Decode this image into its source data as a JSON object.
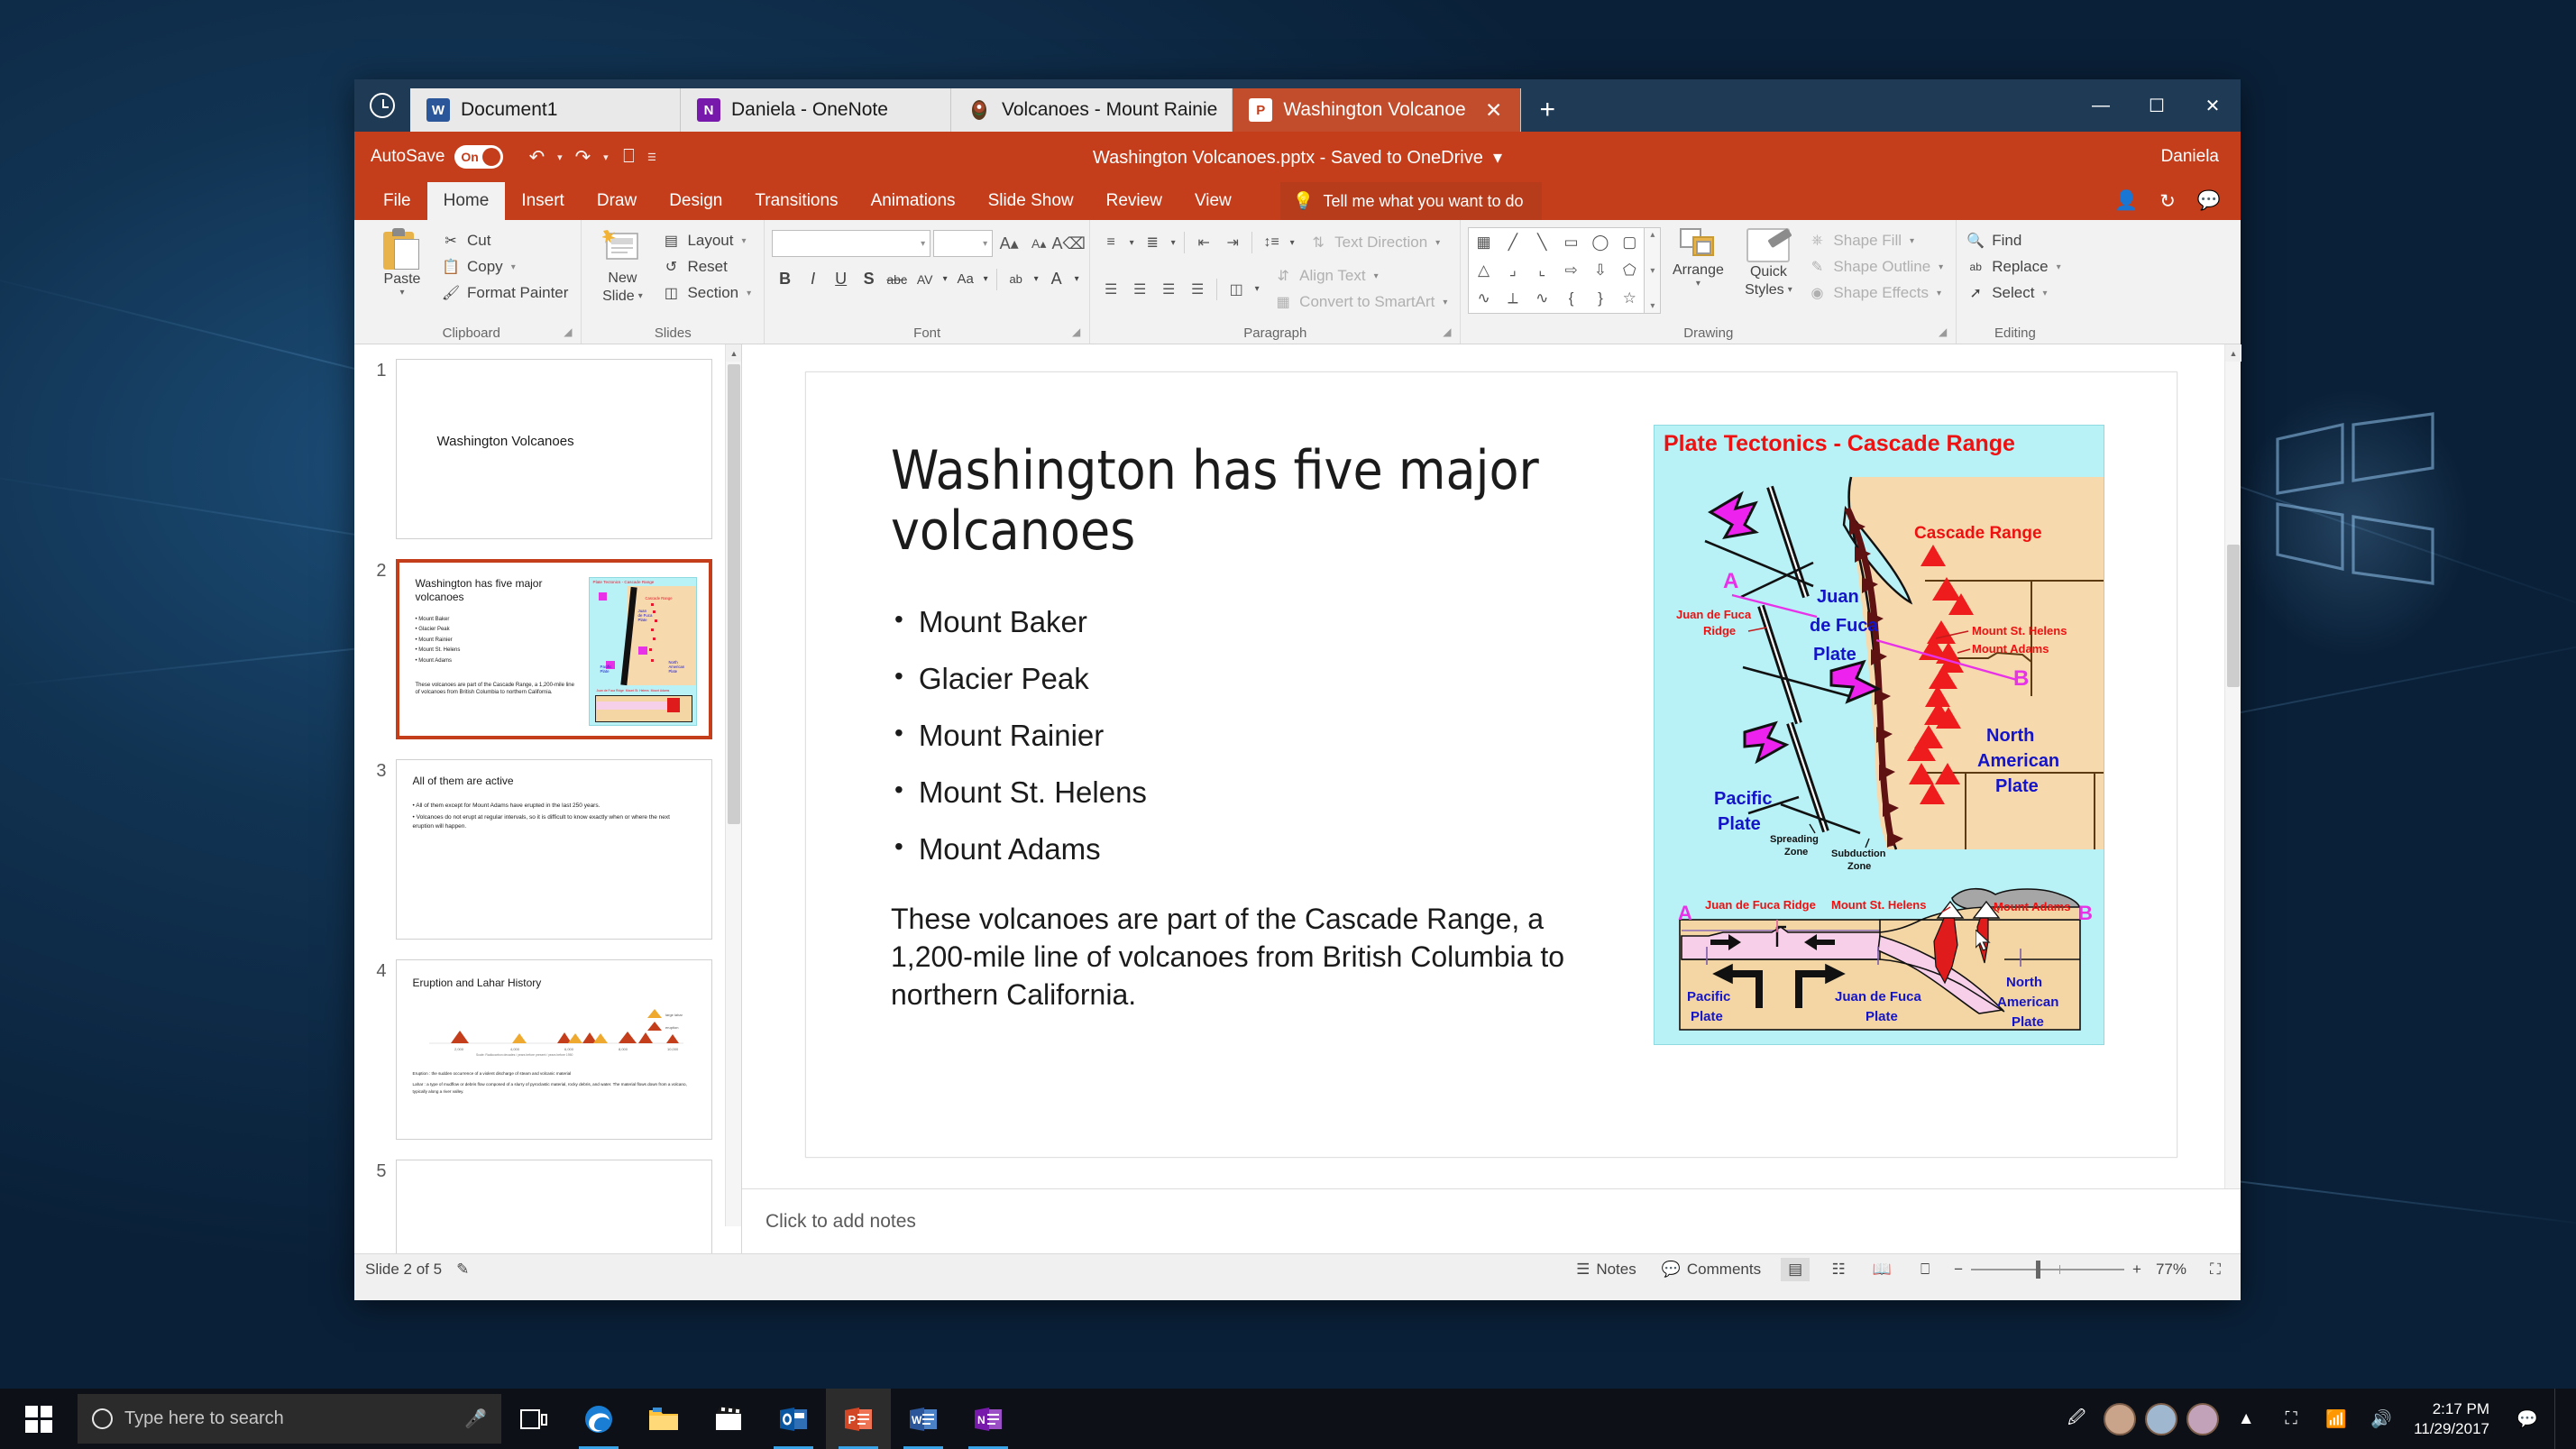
{
  "desktop": {
    "wallpaper_color": "#113352"
  },
  "tabstrip": {
    "history_icon": "clock-icon",
    "tabs": [
      {
        "label": "Document1",
        "icon": "word-icon",
        "active": false
      },
      {
        "label": "Daniela - OneNote",
        "icon": "onenote-icon",
        "active": false
      },
      {
        "label": "Volcanoes - Mount Rainie",
        "icon": "nps-icon",
        "active": false
      },
      {
        "label": "Washington Volcanoe",
        "icon": "powerpoint-icon",
        "active": true
      }
    ],
    "new_tab": "+",
    "window_controls": {
      "minimize": "—",
      "maximize": "☐",
      "close": "✕"
    }
  },
  "titlebar": {
    "autosave_label": "AutoSave",
    "autosave_state": "On",
    "quick_access": [
      "undo-icon",
      "redo-icon",
      "start-presentation-icon",
      "customize-qat-icon"
    ],
    "document_title": "Washington Volcanoes.pptx - Saved to OneDrive",
    "user_name": "Daniela",
    "accent_color": "#c43e1c"
  },
  "ribbon": {
    "tabs": [
      {
        "label": "File",
        "active": false
      },
      {
        "label": "Home",
        "active": true
      },
      {
        "label": "Insert",
        "active": false
      },
      {
        "label": "Draw",
        "active": false
      },
      {
        "label": "Design",
        "active": false
      },
      {
        "label": "Transitions",
        "active": false
      },
      {
        "label": "Animations",
        "active": false
      },
      {
        "label": "Slide Show",
        "active": false
      },
      {
        "label": "Review",
        "active": false
      },
      {
        "label": "View",
        "active": false
      }
    ],
    "tell_me_placeholder": "Tell me what you want to do",
    "right_icons": [
      "share-person-icon",
      "version-history-icon",
      "comments-icon"
    ],
    "groups": {
      "clipboard": {
        "label": "Clipboard",
        "paste": "Paste",
        "cut": "Cut",
        "copy": "Copy",
        "format_painter": "Format Painter"
      },
      "slides": {
        "label": "Slides",
        "new_slide": "New\nSlide",
        "new_slide_line1": "New",
        "new_slide_line2": "Slide",
        "layout": "Layout",
        "reset": "Reset",
        "section": "Section"
      },
      "font": {
        "label": "Font",
        "font_name_value": "",
        "font_size_value": "",
        "bold": "B",
        "italic": "I",
        "underline": "U",
        "shadow": "S",
        "strikethrough": "abc",
        "character_spacing": "AV",
        "change_case": "Aa",
        "text_highlight": "ab",
        "font_color": "A"
      },
      "paragraph": {
        "label": "Paragraph",
        "text_direction": "Text Direction",
        "align_text": "Align Text",
        "convert_to_smartart": "Convert to SmartArt"
      },
      "drawing": {
        "label": "Drawing",
        "arrange": "Arrange",
        "quick_styles_line1": "Quick",
        "quick_styles_line2": "Styles",
        "shape_fill": "Shape Fill",
        "shape_outline": "Shape Outline",
        "shape_effects": "Shape Effects",
        "shape_glyphs": [
          "☷",
          "╲",
          "╲",
          "▭",
          "◯",
          "▢",
          "△",
          "┐",
          "┘",
          "⇨",
          "⇩",
          "⬒",
          "⤳",
          "◠",
          "∿",
          "{",
          "}",
          "☆"
        ]
      },
      "editing": {
        "label": "Editing",
        "find": "Find",
        "replace": "Replace",
        "select": "Select"
      }
    }
  },
  "thumbnails": [
    {
      "number": "1",
      "selected": false,
      "title": "Washington Volcanoes",
      "bullets": [],
      "paragraph": "",
      "has_image": false
    },
    {
      "number": "2",
      "selected": true,
      "title": "Washington has five major volcanoes",
      "bullets": [
        "Mount Baker",
        "Glacier Peak",
        "Mount Rainier",
        "Mount St. Helens",
        "Mount Adams"
      ],
      "paragraph": "These volcanoes are part of the Cascade Range, a 1,200-mile line of volcanoes from British Columbia to northern California.",
      "has_image": true
    },
    {
      "number": "3",
      "selected": false,
      "title": "All of them are active",
      "bullets": [
        "All of them except for Mount Adams have erupted in the last 250 years.",
        "Volcanoes do not erupt at regular intervals, so it is difficult to know exactly when or where the next eruption will happen."
      ],
      "paragraph": "",
      "has_image": false
    },
    {
      "number": "4",
      "selected": false,
      "title": "Eruption and Lahar History",
      "bullets": [],
      "paragraph": "Eruption : the sudden occurrence of a violent discharge of steam and volcanic material",
      "paragraph2": "Lahar : a type of mudflow or debris flow composed of a slurry of pyroclastic material, rocky debris, and water. The material flows down from a volcano, typically along a river valley.",
      "has_image": false,
      "chart_legend": [
        "large lahar",
        "eruption"
      ],
      "chart_axis": [
        "2,000",
        "4,000",
        "6,000",
        "8,000",
        "10,000"
      ]
    },
    {
      "number": "5",
      "selected": false,
      "title": "",
      "bullets": [],
      "paragraph": "",
      "has_image": false
    }
  ],
  "slide": {
    "title": "Washington has five major volcanoes",
    "bullets": [
      "Mount Baker",
      "Glacier Peak",
      "Mount Rainier",
      "Mount St. Helens",
      "Mount Adams"
    ],
    "paragraph": "These volcanoes are part of the Cascade Range, a 1,200-mile line of volcanoes from British Columbia to northern California.",
    "image": {
      "title": "Plate Tectonics - Cascade Range",
      "background_color": "#b8f2f7",
      "land_color": "#f7d9ae",
      "map_labels": {
        "cascade_range": "Cascade Range",
        "juan_de_fuca_plate_line1": "Juan",
        "juan_de_fuca_plate_line2": "de Fuca",
        "juan_de_fuca_plate_line3": "Plate",
        "pacific_plate_line1": "Pacific",
        "pacific_plate_line2": "Plate",
        "north_american_plate_line1": "North",
        "north_american_plate_line2": "American",
        "north_american_plate_line3": "Plate",
        "juan_de_fuca_ridge_line1": "Juan de Fuca",
        "juan_de_fuca_ridge_line2": "Ridge",
        "mount_st_helens": "Mount St. Helens",
        "mount_adams": "Mount Adams",
        "spreading_zone_line1": "Spreading",
        "spreading_zone_line2": "Zone",
        "subduction_zone_line1": "Subduction",
        "subduction_zone_line2": "Zone",
        "point_a": "A",
        "point_b": "B"
      },
      "cross_section_labels": {
        "point_a": "A",
        "point_b": "B",
        "juan_de_fuca_ridge": "Juan de Fuca Ridge",
        "mount_st_helens": "Mount St. Helens",
        "mount_adams": "Mount Adams",
        "pacific_plate_line1": "Pacific",
        "pacific_plate_line2": "Plate",
        "juan_de_fuca_plate_line1": "Juan de Fuca",
        "juan_de_fuca_plate_line2": "Plate",
        "north_american_plate_line1": "North",
        "north_american_plate_line2": "American",
        "north_american_plate_line3": "Plate"
      }
    }
  },
  "notes": {
    "placeholder": "Click to add notes"
  },
  "statusbar": {
    "slide_indicator": "Slide 2 of 5",
    "accessibility_icon": "accessibility-checker-icon",
    "notes_label": "Notes",
    "comments_label": "Comments",
    "views": [
      "normal-view-icon",
      "slide-sorter-icon",
      "reading-view-icon",
      "slideshow-icon"
    ],
    "zoom_out": "−",
    "zoom_in": "+",
    "zoom_level": "77%",
    "fit_slide_icon": "fit-to-window-icon"
  },
  "taskbar": {
    "start_icon": "windows-start-icon",
    "search_placeholder": "Type here to search",
    "cortana_icon": "cortana-circle-icon",
    "mic_icon": "microphone-icon",
    "task_view_icon": "task-view-icon",
    "pinned": [
      {
        "name": "edge-icon",
        "glyph": "e",
        "color": "#1a7fd4",
        "running": true
      },
      {
        "name": "file-explorer-icon",
        "glyph": "▤",
        "color": "#ffc23b",
        "running": false
      },
      {
        "name": "movies-tv-icon",
        "glyph": "▶",
        "color": "#ffffff",
        "running": false
      },
      {
        "name": "outlook-icon",
        "glyph": "O",
        "color": "#0a56a0",
        "running": true
      },
      {
        "name": "powerpoint-icon",
        "glyph": "P",
        "color": "#d24726",
        "running": true,
        "active": true
      },
      {
        "name": "word-icon",
        "glyph": "W",
        "color": "#2b579a",
        "running": true
      },
      {
        "name": "onenote-icon",
        "glyph": "N",
        "color": "#7719aa",
        "running": true
      }
    ],
    "tray_icons": [
      "pen-icon",
      "avatar-1",
      "avatar-2",
      "avatar-3",
      "show-hidden-icon",
      "battery-icon",
      "network-icon",
      "volume-icon",
      "action-center-icon"
    ],
    "clock_time": "2:17 PM",
    "clock_date": "11/29/2017"
  }
}
